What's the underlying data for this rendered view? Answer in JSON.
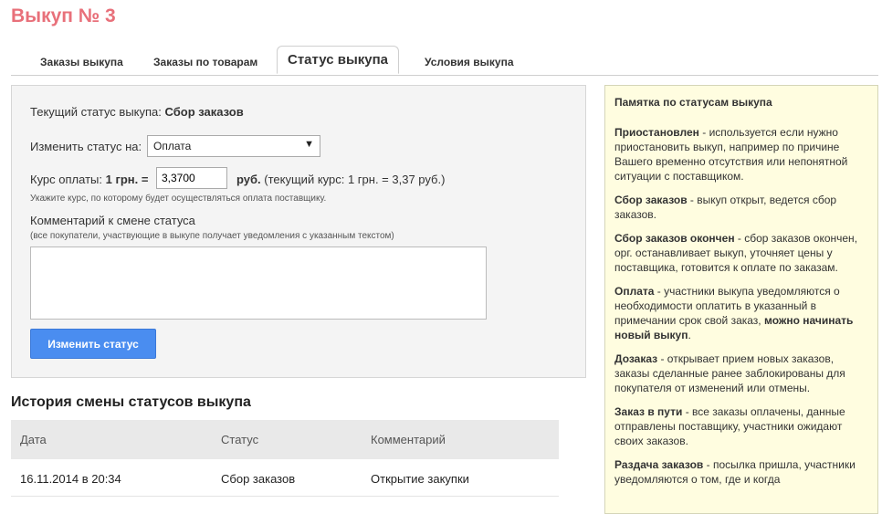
{
  "page": {
    "title": "Выкуп № 3"
  },
  "tabs": [
    {
      "label": "Заказы выкупа"
    },
    {
      "label": "Заказы по товарам"
    },
    {
      "label": "Статус выкупа"
    },
    {
      "label": "Условия выкупа"
    }
  ],
  "status_form": {
    "current_label": "Текущий статус выкупа:",
    "current_value": "Сбор заказов",
    "change_label": "Изменить статус на:",
    "select_value": "Оплата",
    "rate_label": "Курс оплаты:",
    "rate_prefix": "1 грн. =",
    "rate_value": "3,3700",
    "rate_unit": "руб.",
    "rate_current": "(текущий курс: 1 грн. = 3,37 руб.)",
    "rate_hint": "Укажите курс, по которому будет осуществляться оплата поставщику.",
    "comment_label": "Комментарий к смене статуса",
    "comment_hint": "(все покупатели, участвующие в выкупе получает уведомления с указанным текстом)",
    "comment_value": "",
    "submit_label": "Изменить статус"
  },
  "history": {
    "title": "История смены статусов выкупа",
    "columns": [
      "Дата",
      "Статус",
      "Комментарий"
    ],
    "rows": [
      {
        "date": "16.11.2014 в 20:34",
        "status": "Сбор заказов",
        "comment": "Открытие закупки"
      }
    ]
  },
  "memo": {
    "title": "Памятка по статусам выкупа",
    "items": [
      {
        "term": "Приостановлен",
        "text": " - используется если нужно приостановить выкуп, например по причине Вашего временно отсутствия или непонятной ситуации с поставщиком."
      },
      {
        "term": "Сбор заказов",
        "text": " - выкуп открыт, ведется сбор заказов."
      },
      {
        "term": "Сбор заказов окончен",
        "text": " - сбор заказов окончен, орг. останавливает выкуп, уточняет цены у поставщика, готовится к оплате по заказам."
      },
      {
        "term": "Оплата",
        "text": " - участники выкупа уведомляются о необходимости оплатить в указанный в примечании срок свой заказ, ",
        "strong_tail": "можно начинать новый выкуп",
        "tail": "."
      },
      {
        "term": "Дозаказ",
        "text": " - открывает прием новых заказов, заказы сделанные ранее заблокированы для покупателя от изменений или отмены."
      },
      {
        "term": "Заказ в пути",
        "text": " - все заказы оплачены, данные отправлены поставщику, участники ожидают своих заказов."
      },
      {
        "term": "Раздача заказов",
        "text": " - посылка пришла, участники уведомляются о том, где и когда"
      }
    ]
  }
}
